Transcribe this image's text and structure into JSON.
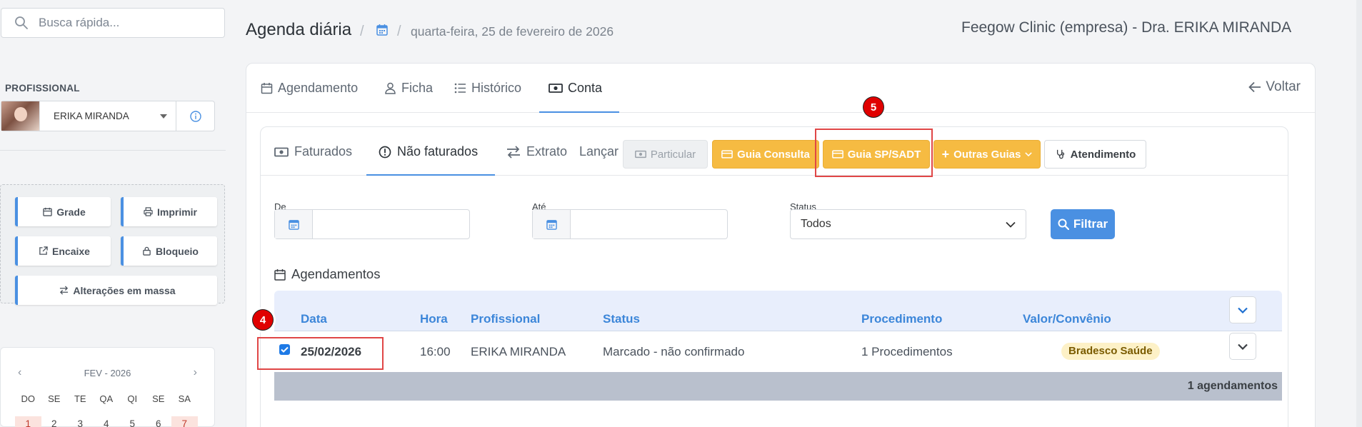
{
  "sidebar": {
    "search_placeholder": "Busca rápida...",
    "section_label": "PROFISSIONAL",
    "professional_name": "ERIKA MIRANDA",
    "actions": {
      "grade": "Grade",
      "imprimir": "Imprimir",
      "encaixe": "Encaixe",
      "bloqueio": "Bloqueio",
      "alteracoes": "Alterações em massa"
    },
    "calendar": {
      "month": "FEV - 2026",
      "weekdays": [
        "DO",
        "SE",
        "TE",
        "QA",
        "QI",
        "SE",
        "SA"
      ],
      "days": [
        "1",
        "2",
        "3",
        "4",
        "5",
        "6",
        "7"
      ]
    }
  },
  "header": {
    "title": "Agenda diária",
    "date": "quarta-feira, 25 de fevereiro de 2026",
    "clinic": "Feegow Clinic (empresa) - Dra. ERIKA MIRANDA"
  },
  "tabs": {
    "agendamento": "Agendamento",
    "ficha": "Ficha",
    "historico": "Histórico",
    "conta": "Conta",
    "voltar": "Voltar"
  },
  "subtabs": {
    "faturados": "Faturados",
    "nao_faturados": "Não faturados",
    "extrato": "Extrato",
    "lancar": "Lançar"
  },
  "buttons": {
    "particular": "Particular",
    "guia_consulta": "Guia Consulta",
    "guia_sadt": "Guia SP/SADT",
    "outras_guias": "Outras Guias",
    "atendimento": "Atendimento",
    "filtrar": "Filtrar"
  },
  "filters": {
    "de_label": "De",
    "ate_label": "Até",
    "status_label": "Status",
    "status_value": "Todos"
  },
  "appointments": {
    "title": "Agendamentos",
    "columns": [
      "Data",
      "Hora",
      "Profissional",
      "Status",
      "Procedimento",
      "Valor/Convênio"
    ],
    "rows": [
      {
        "data": "25/02/2026",
        "hora": "16:00",
        "profissional": "ERIKA MIRANDA",
        "status": "Marcado - não confirmado",
        "procedimento": "1 Procedimentos",
        "convenio": "Bradesco Saúde",
        "checked": true
      }
    ],
    "footer": "1 agendamentos"
  },
  "annotations": {
    "marker_4": "4",
    "marker_5": "5"
  },
  "colors": {
    "accent": "#4a90e2",
    "orange": "#f6bb42",
    "header_blue": "#3c86d9",
    "annotation_red": "#e04646"
  }
}
